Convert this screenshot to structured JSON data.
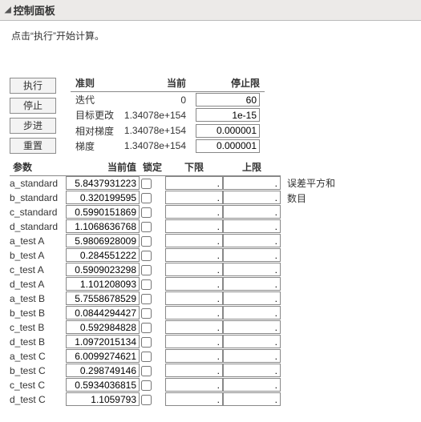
{
  "header": {
    "title": "控制面板"
  },
  "instruction": "点击“执行”开始计算。",
  "buttons": {
    "execute": "执行",
    "stop": "停止",
    "step": "步进",
    "reset": "重置"
  },
  "criteria": {
    "headers": {
      "rule": "准则",
      "current": "当前",
      "stop": "停止限"
    },
    "rows": [
      {
        "label": "迭代",
        "current": "0",
        "stop": "60"
      },
      {
        "label": "目标更改",
        "current": "1.34078e+154",
        "stop": "1e-15"
      },
      {
        "label": "相对梯度",
        "current": "1.34078e+154",
        "stop": "0.000001"
      },
      {
        "label": "梯度",
        "current": "1.34078e+154",
        "stop": "0.000001"
      }
    ]
  },
  "params": {
    "headers": {
      "param": "参数",
      "value": "当前值",
      "lock": "锁定",
      "lower": "下限",
      "upper": "上限"
    },
    "rows": [
      {
        "name": "a_standard",
        "value": "5.8437931223",
        "lower": ".",
        "upper": "."
      },
      {
        "name": "b_standard",
        "value": "0.320199595",
        "lower": ".",
        "upper": "."
      },
      {
        "name": "c_standard",
        "value": "0.5990151869",
        "lower": ".",
        "upper": "."
      },
      {
        "name": "d_standard",
        "value": "1.1068636768",
        "lower": ".",
        "upper": "."
      },
      {
        "name": "a_test A",
        "value": "5.9806928009",
        "lower": ".",
        "upper": "."
      },
      {
        "name": "b_test A",
        "value": "0.284551222",
        "lower": ".",
        "upper": "."
      },
      {
        "name": "c_test A",
        "value": "0.5909023298",
        "lower": ".",
        "upper": "."
      },
      {
        "name": "d_test A",
        "value": "1.101208093",
        "lower": ".",
        "upper": "."
      },
      {
        "name": "a_test B",
        "value": "5.7558678529",
        "lower": ".",
        "upper": "."
      },
      {
        "name": "b_test B",
        "value": "0.0844294427",
        "lower": ".",
        "upper": "."
      },
      {
        "name": "c_test B",
        "value": "0.592984828",
        "lower": ".",
        "upper": "."
      },
      {
        "name": "d_test B",
        "value": "1.0972015134",
        "lower": ".",
        "upper": "."
      },
      {
        "name": "a_test C",
        "value": "6.0099274621",
        "lower": ".",
        "upper": "."
      },
      {
        "name": "b_test C",
        "value": "0.298749146",
        "lower": ".",
        "upper": "."
      },
      {
        "name": "c_test C",
        "value": "0.5934036815",
        "lower": ".",
        "upper": "."
      },
      {
        "name": "d_test C",
        "value": "1.1059793",
        "lower": ".",
        "upper": "."
      }
    ]
  },
  "side": {
    "sse": "误差平方和",
    "count": "数目"
  }
}
